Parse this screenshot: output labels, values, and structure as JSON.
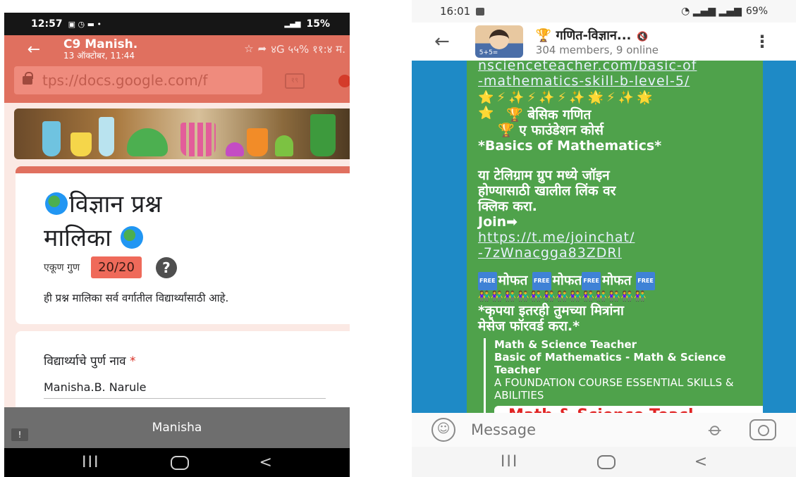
{
  "left": {
    "status": {
      "time": "12:57",
      "battery": "15%",
      "network": "4G"
    },
    "topbar": {
      "title": "C9 Manish.",
      "subtitle": "13 ऑक्टोबर, 11:44",
      "overlay": "४G ५५% ११:४ म."
    },
    "url": "tps://docs.google.com/f",
    "tab_count": "१९",
    "form": {
      "title_line1": "विज्ञान प्रश्न",
      "title_line2": "मालिका",
      "score_label": "एकूण गुण",
      "score_value": "20/20",
      "help_glyph": "?",
      "description": "ही प्रश्न मालिका सर्व वर्गातील विद्यार्थ्यांसाठी आहे.",
      "question_label": "विद्यार्थ्याचे पुर्ण नाव",
      "required_mark": "*",
      "answer": "Manisha.B. Narule"
    },
    "toast": "Manisha",
    "nav": {
      "back": "<",
      "recent": "III"
    }
  },
  "right": {
    "status": {
      "time": "16:01",
      "battery": "69%"
    },
    "header": {
      "group_name": "🏆 गणित-विज्ञान...",
      "members": "304 members, 9 online",
      "avatar_text": "5+5="
    },
    "message": {
      "url_line1": "nscienceteacher.com/basic-of",
      "url_line2": "-mathematics-skill-b-level-5/",
      "sparkles": "⭐⚡✨⚡✨⚡✨🌟⚡✨🌟",
      "star": "⭐",
      "line_hindi1": "बेसिक गणित",
      "line_hindi2": "ए फाउंडेशन कोर्स",
      "line_en": "*Basics of Mathematics*",
      "join_text1": "या टेलिग्राम ग्रुप मध्ये जॉइन",
      "join_text2": "होण्यासाठी खालील लिंक वर",
      "join_text3": "क्लिक करा.",
      "join_label": "Join",
      "join_arrow": "➡",
      "join_link1": "https://t.me/joinchat/",
      "join_link2": "-7zWnacgga83ZDRl",
      "free_tag": "FREE",
      "free_word": "मोफत",
      "people_row": "👫👫👫👫👫👫👫👫👫👫👫👫👫",
      "forward1": "*कृपया इतरही तुमच्या मित्रांना",
      "forward2": "मेसेज फॉरवर्ड करा.*",
      "preview_site": "Math & Science Teacher",
      "preview_title": "Basic of Mathematics - Math & Science Teacher",
      "preview_desc": "A FOUNDATION COURSE ESSENTIAL SKILLS & ABILITIES",
      "preview_card": "Math & Science Teacl"
    },
    "composer_placeholder": "Message",
    "nav": {
      "back": "<",
      "recent": "III"
    }
  },
  "colors": {
    "google_form_accent": "#e0705f",
    "telegram_bg": "#1e8ac6",
    "bubble_green": "#4fa24b"
  }
}
